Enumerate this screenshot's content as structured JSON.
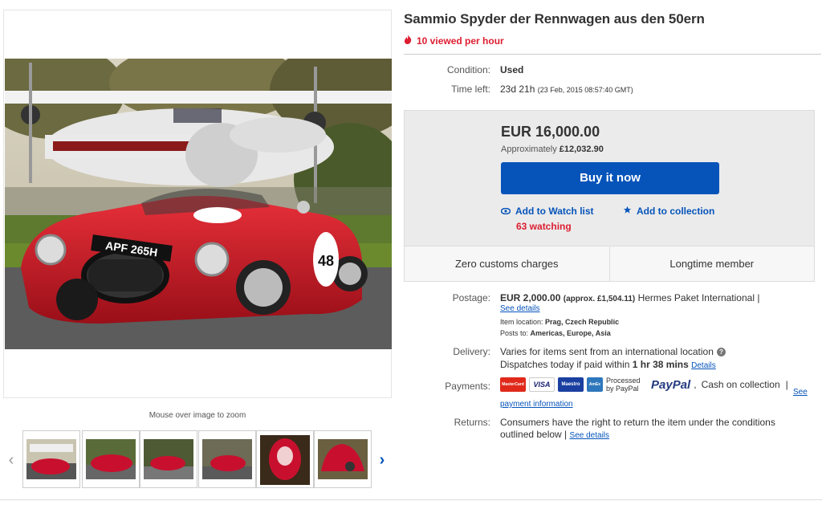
{
  "title": "Sammio Spyder der Rennwagen aus den 50ern",
  "hot": {
    "text": "10 viewed per hour"
  },
  "condition": {
    "label": "Condition:",
    "value": "Used"
  },
  "time_left": {
    "label": "Time left:",
    "value": "23d 21h",
    "detail": "(23 Feb, 2015   08:57:40 GMT)"
  },
  "price": {
    "main": "EUR 16,000.00",
    "approx_prefix": "Approximately ",
    "approx_value": "£12,032.90",
    "buy_label": "Buy it now",
    "watch_label": "Add to Watch list",
    "watching": "63 watching",
    "collection_label": "Add to collection"
  },
  "badges": [
    "Zero customs charges",
    "Longtime member"
  ],
  "postage": {
    "label": "Postage:",
    "amount": "EUR 2,000.00",
    "approx": "(approx. £1,504.11)",
    "service": "Hermes Paket International |",
    "see_details": "See details",
    "location_label": "Item location:",
    "location_value": "Prag, Czech Republic",
    "posts_label": "Posts to:",
    "posts_value": "Americas, Europe, Asia"
  },
  "delivery": {
    "label": "Delivery:",
    "line1": "Varies for items sent from an international location",
    "line2_prefix": "Dispatches today if paid within ",
    "line2_time": "1 hr 38 mins",
    "details_link": "Details"
  },
  "payments": {
    "label": "Payments:",
    "cards": [
      "MasterCard",
      "VISA",
      "Maestro",
      "AmEx"
    ],
    "processed": "Processed by PayPal",
    "paypal": "PayPal",
    "comma": ",",
    "cash": "Cash on collection",
    "sep": "|",
    "see_payment_info": "See payment information"
  },
  "returns": {
    "label": "Returns:",
    "text": "Consumers have the right to return the item under the conditions outlined below |",
    "see_details": "See details"
  },
  "gallery": {
    "zoom_hint": "Mouse over image to zoom",
    "prev_icon": "chevron-left-icon",
    "next_icon": "chevron-right-icon",
    "plate": "APF 265H",
    "race_number": "48",
    "thumb_count": 6
  },
  "colors": {
    "accent_blue": "#0654ba",
    "alert_red": "#dd1e31",
    "car_red": "#c8102e"
  }
}
